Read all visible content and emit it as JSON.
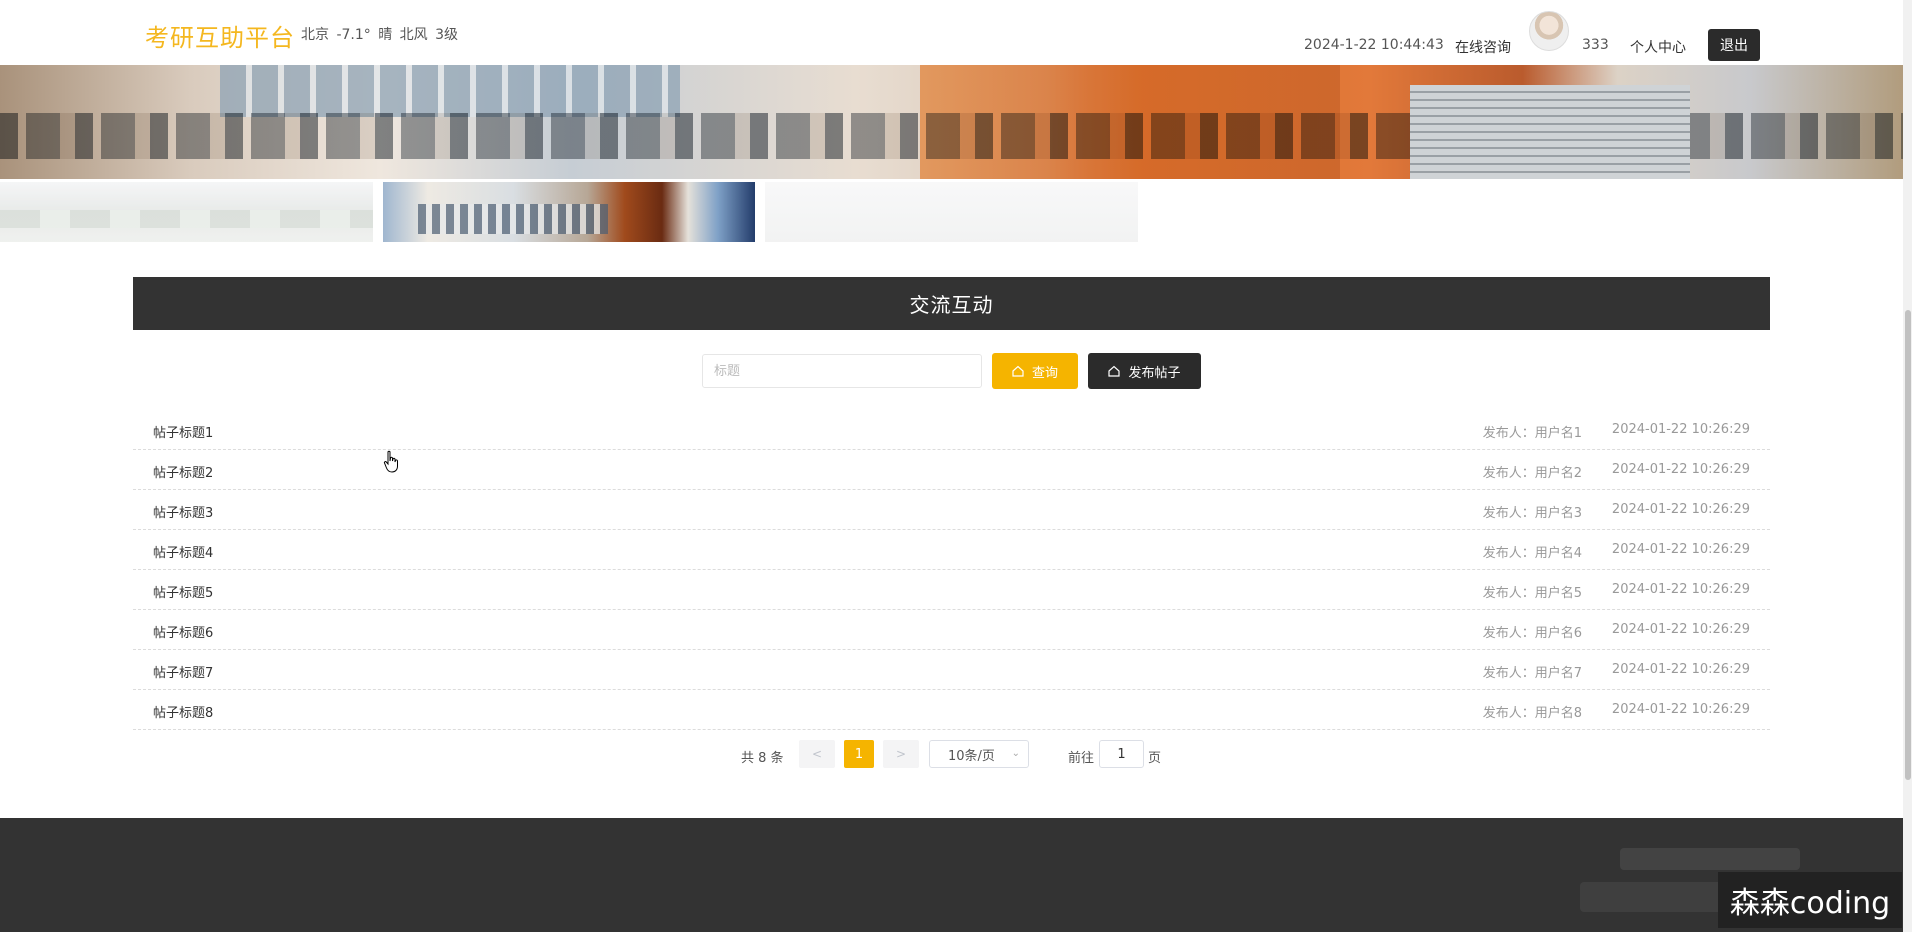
{
  "header": {
    "logo": "考研互助平台",
    "weather": "北京  -7.1°  晴  北风  3级",
    "datetime": "2024-1-22 10:44:43",
    "consult": "在线咨询",
    "username": "333",
    "profile": "个人中心",
    "logout": "退出"
  },
  "section": {
    "title": "交流互动"
  },
  "search": {
    "placeholder": "标题",
    "query_label": "查询",
    "publish_label": "发布帖子"
  },
  "posts": [
    {
      "title": "帖子标题1",
      "author": "发布人：用户名1",
      "time": "2024-01-22 10:26:29"
    },
    {
      "title": "帖子标题2",
      "author": "发布人：用户名2",
      "time": "2024-01-22 10:26:29"
    },
    {
      "title": "帖子标题3",
      "author": "发布人：用户名3",
      "time": "2024-01-22 10:26:29"
    },
    {
      "title": "帖子标题4",
      "author": "发布人：用户名4",
      "time": "2024-01-22 10:26:29"
    },
    {
      "title": "帖子标题5",
      "author": "发布人：用户名5",
      "time": "2024-01-22 10:26:29"
    },
    {
      "title": "帖子标题6",
      "author": "发布人：用户名6",
      "time": "2024-01-22 10:26:29"
    },
    {
      "title": "帖子标题7",
      "author": "发布人：用户名7",
      "time": "2024-01-22 10:26:29"
    },
    {
      "title": "帖子标题8",
      "author": "发布人：用户名8",
      "time": "2024-01-22 10:26:29"
    }
  ],
  "pagination": {
    "total": "共 8 条",
    "prev": "<",
    "current": "1",
    "next": ">",
    "page_size": "10条/页",
    "goto_prefix": "前往",
    "goto_value": "1",
    "goto_suffix": "页"
  },
  "watermark": "森森coding",
  "colors": {
    "accent": "#f5b400",
    "logo": "#f4b71f",
    "dark": "#333333"
  }
}
